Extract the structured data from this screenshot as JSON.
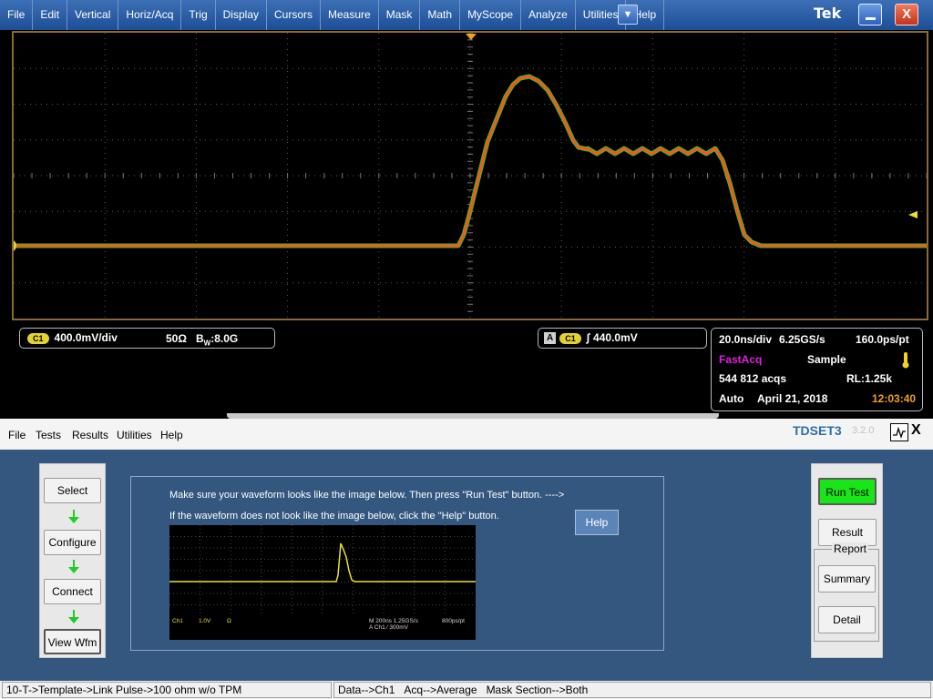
{
  "menubar": {
    "items": [
      "File",
      "Edit",
      "Vertical",
      "Horiz/Acq",
      "Trig",
      "Display",
      "Cursors",
      "Measure",
      "Mask",
      "Math",
      "MyScope",
      "Analyze",
      "Utilities",
      "Help"
    ],
    "dropdown_glyph": "▼",
    "logo": "Tek",
    "close_glyph": "X"
  },
  "scope": {
    "channel_marker": "1",
    "ch1": {
      "badge": "C1",
      "scale": "400.0mV/div",
      "termination": "50Ω",
      "bandwidth_prefix": "B",
      "bandwidth_sub": "W",
      "bandwidth_value": ":8.0G"
    },
    "trigger": {
      "mode_badge": "A",
      "source_badge": "C1",
      "slope_glyph": "∫",
      "level": "440.0mV"
    },
    "horizontal": {
      "scale": "20.0ns/div",
      "sample_rate": "6.25GS/s",
      "resolution": "160.0ps/pt",
      "acq_mode": "FastAcq",
      "sample_mode": "Sample",
      "acq_count": "544 812 acqs",
      "record_length": "RL:1.25k",
      "trigger_mode": "Auto",
      "date": "April 21, 2018",
      "time": "12:03:40"
    },
    "colors": {
      "trace": "#f05a14",
      "trace_edge": "#3fb83a",
      "grid": "#5a5a5a",
      "ch1": "#e6d22e",
      "fastacq": "#e020e0",
      "time": "#f0a020",
      "frame": "#8a6a32"
    }
  },
  "app": {
    "menu": [
      "File",
      "Tests",
      "Results",
      "Utilities",
      "Help"
    ],
    "title": "TDSET3",
    "title_ghost": "3.2.0",
    "close_glyph": "X",
    "flow_buttons": [
      "Select",
      "Configure",
      "Connect",
      "View Wfm"
    ],
    "instruction_line1": "Make sure your waveform looks like the image below. Then press \"Run Test\" button. ---->",
    "instruction_line2": "If the waveform does not look like the image below, click the \"Help\" button.",
    "help_label": "Help",
    "run_test_label": "Run Test",
    "result_label": "Result",
    "report_label": "Report",
    "summary_label": "Summary",
    "detail_label": "Detail",
    "ref_image": {
      "ch": "Ch1",
      "scale": "1.0V",
      "term": "Ω",
      "timebase": "M 200ns 1.25GS/s",
      "resolution": "800ps/pt",
      "trigger": "A  Ch1  ∕  300mV"
    },
    "status": {
      "path": "10-T->Template->Link Pulse->100 ohm w/o TPM",
      "data": "Data-->Ch1",
      "acq": "Acq-->Average",
      "mask": "Mask Section-->Both"
    }
  }
}
